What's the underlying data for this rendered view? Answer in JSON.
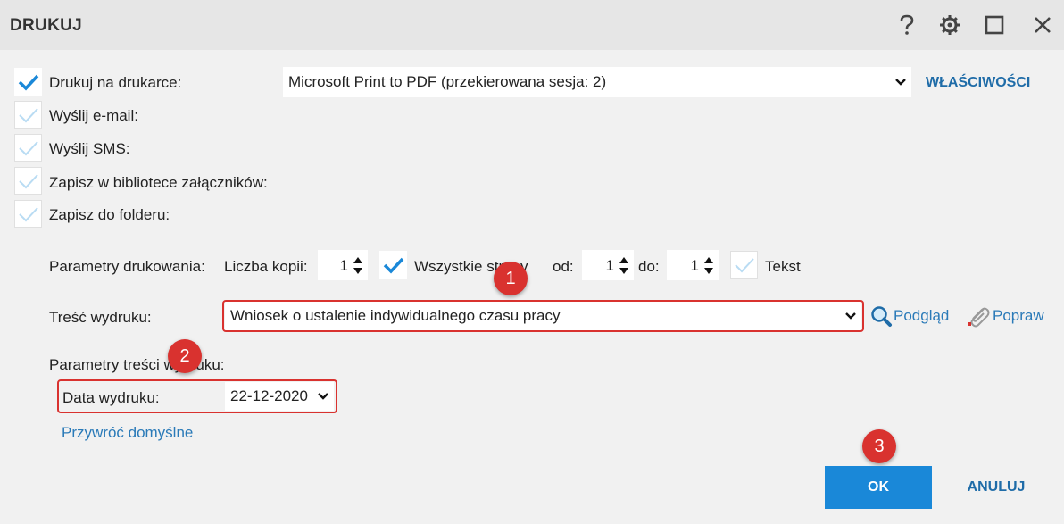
{
  "window": {
    "title": "DRUKUJ"
  },
  "options": [
    {
      "label": "Drukuj na drukarce:",
      "checked": true
    },
    {
      "label": "Wyślij e-mail:",
      "checked": false
    },
    {
      "label": "Wyślij SMS:",
      "checked": false
    },
    {
      "label": "Zapisz w bibliotece załączników:",
      "checked": false
    },
    {
      "label": "Zapisz do folderu:",
      "checked": false
    }
  ],
  "printer": {
    "selected": "Microsoft Print to PDF (przekierowana sesja: 2)",
    "properties_label": "WŁAŚCIWOŚCI"
  },
  "params": {
    "label": "Parametry drukowania:",
    "copies_label": "Liczba kopii:",
    "copies": "1",
    "all_pages_label": "Wszystkie strony",
    "all_pages_checked": true,
    "from_label": "od:",
    "from": "1",
    "to_label": "do:",
    "to": "1",
    "text_label": "Tekst",
    "text_checked": false
  },
  "content": {
    "label": "Treść wydruku:",
    "selected": "Wniosek o ustalenie indywidualnego czasu pracy",
    "preview_label": "Podgląd",
    "fix_label": "Popraw"
  },
  "content_params": {
    "label": "Parametry treści wydruku:",
    "date_label": "Data wydruku:",
    "date": "22-12-2020",
    "restore_label": "Przywróć domyślne"
  },
  "badges": [
    "1",
    "2",
    "3"
  ],
  "buttons": {
    "ok": "OK",
    "cancel": "ANULUJ"
  },
  "colors": {
    "accent": "#1a88d8",
    "highlight": "#d9322f",
    "check": "#1a88d8"
  }
}
